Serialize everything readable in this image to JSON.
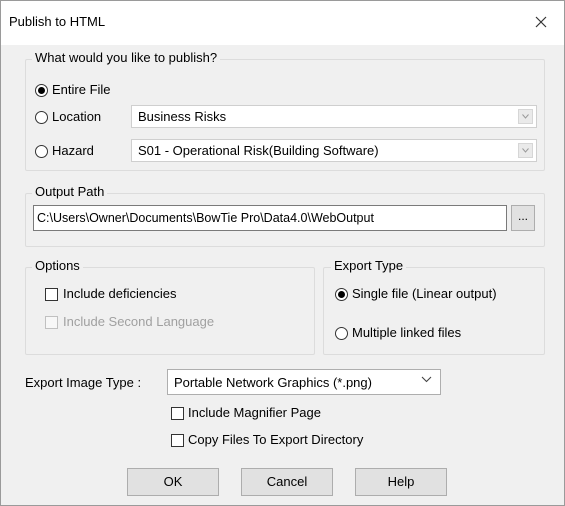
{
  "window": {
    "title": "Publish to HTML"
  },
  "publish_group": {
    "legend": "What would you like to publish?",
    "entire_file_label": "Entire File",
    "location_label": "Location",
    "location_value": "Business Risks",
    "hazard_label": "Hazard",
    "hazard_value": "S01 - Operational Risk(Building Software)",
    "selected": "Entire File"
  },
  "output_group": {
    "legend": "Output Path",
    "path_value": "C:\\Users\\Owner\\Documents\\BowTie Pro\\Data4.0\\WebOutput",
    "browse_label": "..."
  },
  "options_group": {
    "legend": "Options",
    "include_deficiencies_label": "Include deficiencies",
    "include_deficiencies_checked": false,
    "include_second_language_label": "Include Second Language",
    "include_second_language_checked": false,
    "include_second_language_enabled": false
  },
  "export_type_group": {
    "legend": "Export Type",
    "single_file_label": "Single file (Linear output)",
    "multiple_files_label": "Multiple linked files",
    "selected": "Single file (Linear output)"
  },
  "export_image": {
    "label": "Export Image Type :",
    "selected_value": "Portable Network Graphics (*.png)"
  },
  "extra_options": {
    "include_magnifier_label": "Include Magnifier Page",
    "include_magnifier_checked": false,
    "copy_files_label": "Copy Files To Export Directory",
    "copy_files_checked": false
  },
  "buttons": {
    "ok": "OK",
    "cancel": "Cancel",
    "help": "Help"
  },
  "icons": {
    "close": "close-icon",
    "combo_arrow": "chevron-down-icon",
    "select_arrow": "chevron-down-icon"
  }
}
